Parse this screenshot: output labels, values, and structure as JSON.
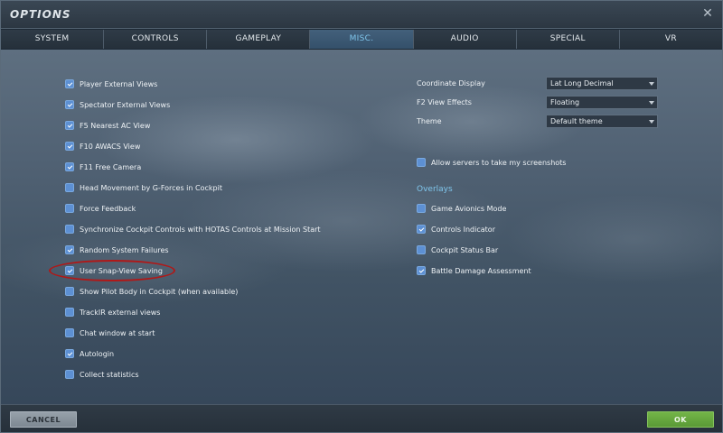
{
  "window": {
    "title": "OPTIONS",
    "close_icon": "close-icon"
  },
  "tabs": [
    {
      "label": "SYSTEM",
      "active": false
    },
    {
      "label": "CONTROLS",
      "active": false
    },
    {
      "label": "GAMEPLAY",
      "active": false
    },
    {
      "label": "MISC.",
      "active": true
    },
    {
      "label": "AUDIO",
      "active": false
    },
    {
      "label": "SPECIAL",
      "active": false
    },
    {
      "label": "VR",
      "active": false
    }
  ],
  "left_options": [
    {
      "label": "Player External Views",
      "checked": true
    },
    {
      "label": "Spectator External Views",
      "checked": true
    },
    {
      "label": "F5 Nearest AC View",
      "checked": true
    },
    {
      "label": "F10 AWACS View",
      "checked": true
    },
    {
      "label": "F11 Free Camera",
      "checked": true
    },
    {
      "label": "Head Movement by G-Forces in Cockpit",
      "checked": false
    },
    {
      "label": "Force Feedback",
      "checked": false
    },
    {
      "label": "Synchronize Cockpit Controls with HOTAS Controls at Mission Start",
      "checked": false
    },
    {
      "label": "Random System Failures",
      "checked": true
    },
    {
      "label": "User Snap-View Saving",
      "checked": true
    },
    {
      "label": "Show Pilot Body in Cockpit (when available)",
      "checked": false
    },
    {
      "label": "TrackIR external views",
      "checked": false
    },
    {
      "label": "Chat window at start",
      "checked": false
    },
    {
      "label": "Autologin",
      "checked": true
    },
    {
      "label": "Collect statistics",
      "checked": false
    }
  ],
  "settings": {
    "coordinate_display": {
      "label": "Coordinate Display",
      "value": "Lat Long Decimal"
    },
    "f2_view_effects": {
      "label": "F2 View Effects",
      "value": "Floating"
    },
    "theme": {
      "label": "Theme",
      "value": "Default theme"
    }
  },
  "screenshots_option": {
    "label": "Allow servers to take my screenshots",
    "checked": false
  },
  "overlays": {
    "title": "Overlays",
    "items": [
      {
        "label": "Game Avionics Mode",
        "checked": false
      },
      {
        "label": "Controls Indicator",
        "checked": true
      },
      {
        "label": "Cockpit Status Bar",
        "checked": false
      },
      {
        "label": "Battle Damage Assessment",
        "checked": true
      }
    ]
  },
  "footer": {
    "cancel_label": "CANCEL",
    "ok_label": "OK"
  },
  "colors": {
    "accent": "#7fc6ec",
    "checkbox": "#5d90d3",
    "ok_button": "#5a9a36",
    "highlight_ring": "#b01818"
  }
}
